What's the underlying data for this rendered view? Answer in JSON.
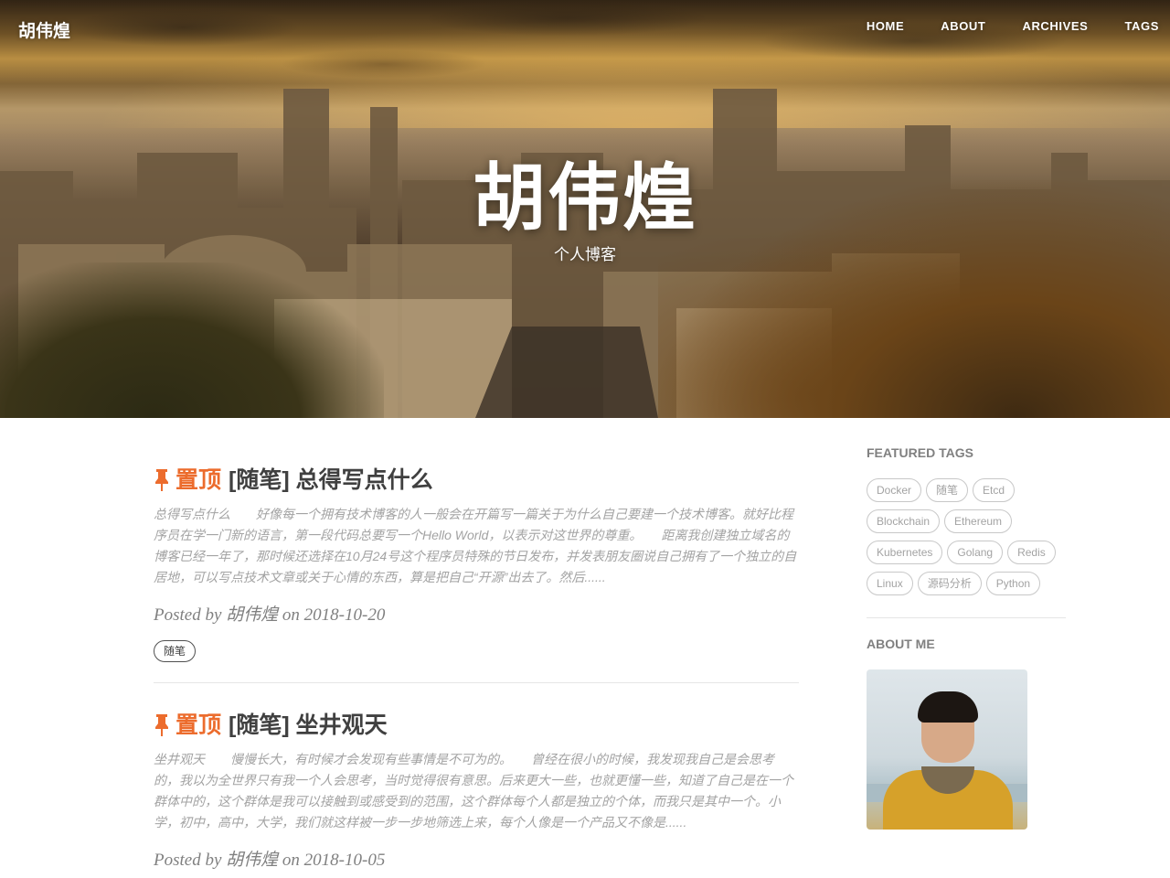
{
  "header": {
    "brand": "胡伟煌",
    "nav": [
      "HOME",
      "ABOUT",
      "ARCHIVES",
      "TAGS"
    ],
    "title": "胡伟煌",
    "subtitle": "个人博客"
  },
  "posts": [
    {
      "pin_label": "置顶",
      "title": "[随笔] 总得写点什么",
      "excerpt": "总得写点什么　　好像每一个拥有技术博客的人一般会在开篇写一篇关于为什么自己要建一个技术博客。就好比程序员在学一门新的语言，第一段代码总要写一个Hello World，以表示对这世界的尊重。　　距离我创建独立域名的博客已经一年了，那时候还选择在10月24号这个程序员特殊的节日发布，并发表朋友圈说自己拥有了一个独立的自居地，可以写点技术文章或关于心情的东西，算是把自己“开源”出去了。然后......",
      "posted_by_prefix": "Posted by",
      "author": "胡伟煌",
      "date_prefix": "on",
      "date": "2018-10-20",
      "tag": "随笔"
    },
    {
      "pin_label": "置顶",
      "title": "[随笔] 坐井观天",
      "excerpt": "坐井观天　　慢慢长大，有时候才会发现有些事情是不可为的。　　曾经在很小的时候，我发现我自己是会思考的，我以为全世界只有我一个人会思考，当时觉得很有意思。后来更大一些，也就更懂一些，知道了自己是在一个群体中的，这个群体是我可以接触到或感受到的范围，这个群体每个人都是独立的个体，而我只是其中一个。小学，初中，高中，大学，我们就这样被一步一步地筛选上来，每个人像是一个产品又不像是......",
      "posted_by_prefix": "Posted by",
      "author": "胡伟煌",
      "date_prefix": "on",
      "date": "2018-10-05"
    }
  ],
  "sidebar": {
    "featured_tags_title": "FEATURED TAGS",
    "tags": [
      "Docker",
      "随笔",
      "Etcd",
      "Blockchain",
      "Ethereum",
      "Kubernetes",
      "Golang",
      "Redis",
      "Linux",
      "源码分析",
      "Python"
    ],
    "about_title": "ABOUT ME"
  },
  "colors": {
    "accent": "#ec6c2d",
    "text": "#404040",
    "muted": "#a3a3a3"
  },
  "icons": {
    "pin": "pushpin-icon"
  }
}
